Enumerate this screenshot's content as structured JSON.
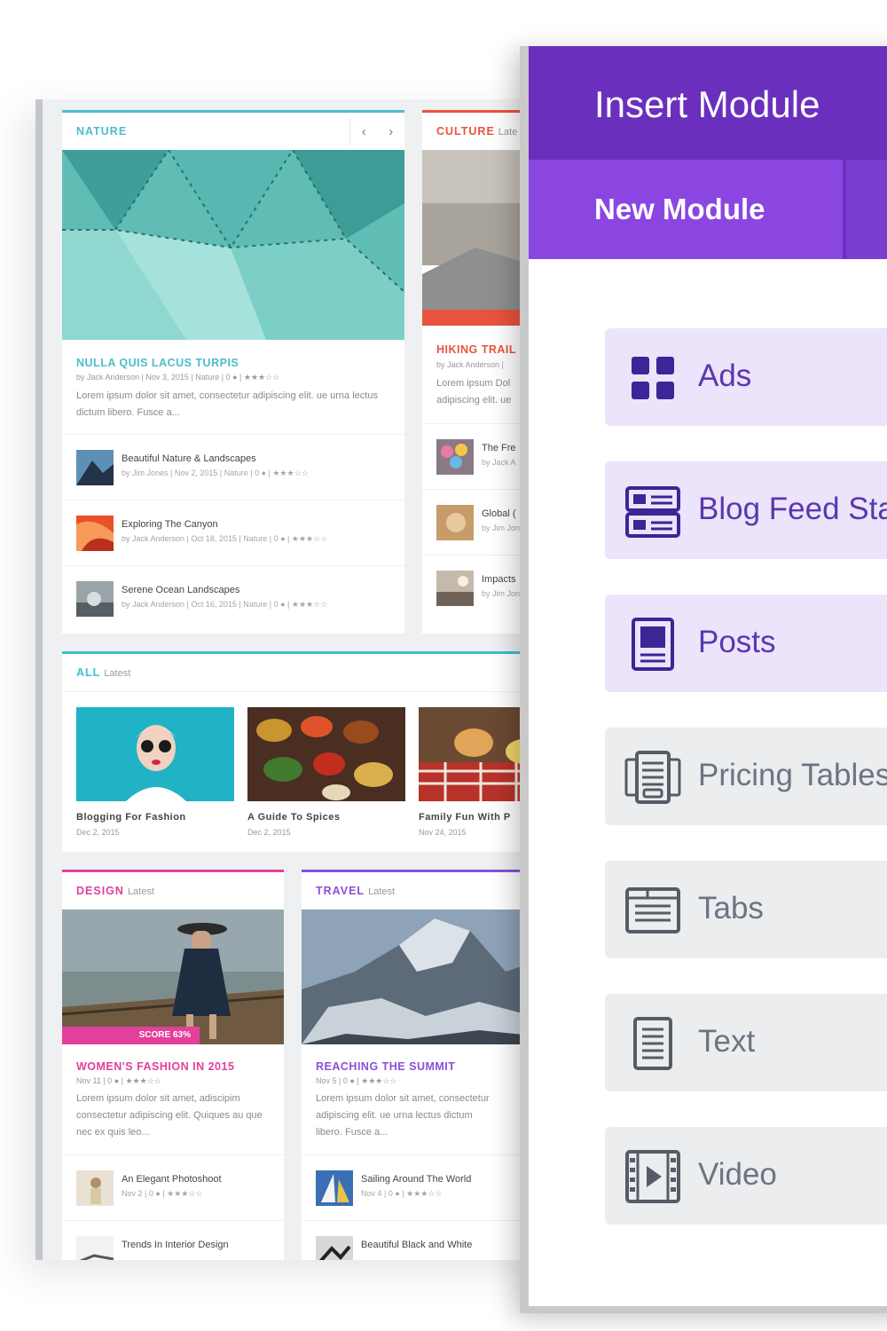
{
  "colors": {
    "nature": "#4dbdcb",
    "culture": "#e9533e",
    "all": "#3bbfd4",
    "design": "#e2409a",
    "travel": "#8a50d8",
    "panel_header": "#6b2fbd",
    "panel_tab": "#8b46e2",
    "module_active_bg": "#ebe4fa",
    "module_active_text": "#5a37b0",
    "module_bg": "#ebedef",
    "module_text": "#6b7480"
  },
  "magazine": {
    "nature": {
      "category": "NATURE",
      "arrow_prev": "‹",
      "arrow_next": "›",
      "featured_title": "NULLA QUIS LACUS TURPIS",
      "featured_meta": "by Jack Anderson | Nov 3, 2015 | Nature | 0 ● | ★★★☆☆",
      "featured_excerpt": "Lorem ipsum dolor sit amet, consectetur adipiscing elit. ue urna lectus dictum libero. Fusce a...",
      "rows": [
        {
          "title": "Beautiful Nature & Landscapes",
          "meta": "by Jim Jones | Nov 2, 2015 | Nature | 0 ● | ★★★☆☆"
        },
        {
          "title": "Exploring The Canyon",
          "meta": "by Jack Anderson | Oct 18, 2015 | Nature | 0 ● | ★★★☆☆"
        },
        {
          "title": "Serene Ocean Landscapes",
          "meta": "by Jack Anderson | Oct 16, 2015 | Nature | 0 ● | ★★★☆☆"
        }
      ]
    },
    "culture": {
      "category": "CULTURE",
      "latest": "Late",
      "featured_title": "HIKING TRAIL",
      "featured_meta": "by Jack Anderson | ",
      "featured_excerpt": "Lorem ipsum Dol adipiscing elit. ue",
      "rows": [
        {
          "title": "The Fre",
          "meta": "by Jack A"
        },
        {
          "title": "Global (",
          "meta": "by Jim Jon"
        },
        {
          "title": "Impacts",
          "meta": "by Jim Jon"
        }
      ]
    },
    "all": {
      "category": "ALL",
      "latest": "Latest",
      "items": [
        {
          "title": "Blogging For Fashion",
          "date": "Dec 2, 2015"
        },
        {
          "title": "A Guide To Spices",
          "date": "Dec 2, 2015"
        },
        {
          "title": "Family Fun With P",
          "date": "Nov 24, 2015"
        }
      ]
    },
    "design": {
      "category": "DESIGN",
      "latest": "Latest",
      "score": "SCORE 63%",
      "featured_title": "WOMEN'S FASHION IN 2015",
      "featured_meta": "Nov 11 | 0 ● | ★★★☆☆",
      "featured_excerpt": "Lorem ipsum dolor sit amet, adiscipim consectetur adipiscing elit. Quiques au que nec ex quis leo...",
      "rows": [
        {
          "title": "An Elegant Photoshoot",
          "meta": "Nov 2 | 0 ● | ★★★☆☆"
        },
        {
          "title": "Trends In Interior Design",
          "meta": ""
        }
      ]
    },
    "travel": {
      "category": "TRAVEL",
      "latest": "Latest",
      "featured_title": "REACHING THE SUMMIT",
      "featured_meta": "Nov 5 | 0 ● | ★★★☆☆",
      "featured_excerpt": "Lorem ipsum dolor sit amet, consectetur adipiscing elit. ue urna lectus dictum libero. Fusce a...",
      "rows": [
        {
          "title": "Sailing Around The World",
          "meta": "Nov 4 | 0 ● | ★★★☆☆"
        },
        {
          "title": "Beautiful Black and White",
          "meta": ""
        }
      ]
    }
  },
  "panel": {
    "title": "Insert Module",
    "tab_label": "New Module",
    "modules": [
      {
        "label": "Ads",
        "icon": "grid-icon",
        "highlighted": true
      },
      {
        "label": "Blog Feed Sta",
        "icon": "blog-feed-icon",
        "highlighted": true
      },
      {
        "label": "Posts",
        "icon": "posts-icon",
        "highlighted": true
      },
      {
        "label": "Pricing Tables",
        "icon": "pricing-table-icon",
        "highlighted": false
      },
      {
        "label": "Tabs",
        "icon": "tabs-icon",
        "highlighted": false
      },
      {
        "label": "Text",
        "icon": "text-document-icon",
        "highlighted": false
      },
      {
        "label": "Video",
        "icon": "video-film-icon",
        "highlighted": false
      }
    ]
  }
}
